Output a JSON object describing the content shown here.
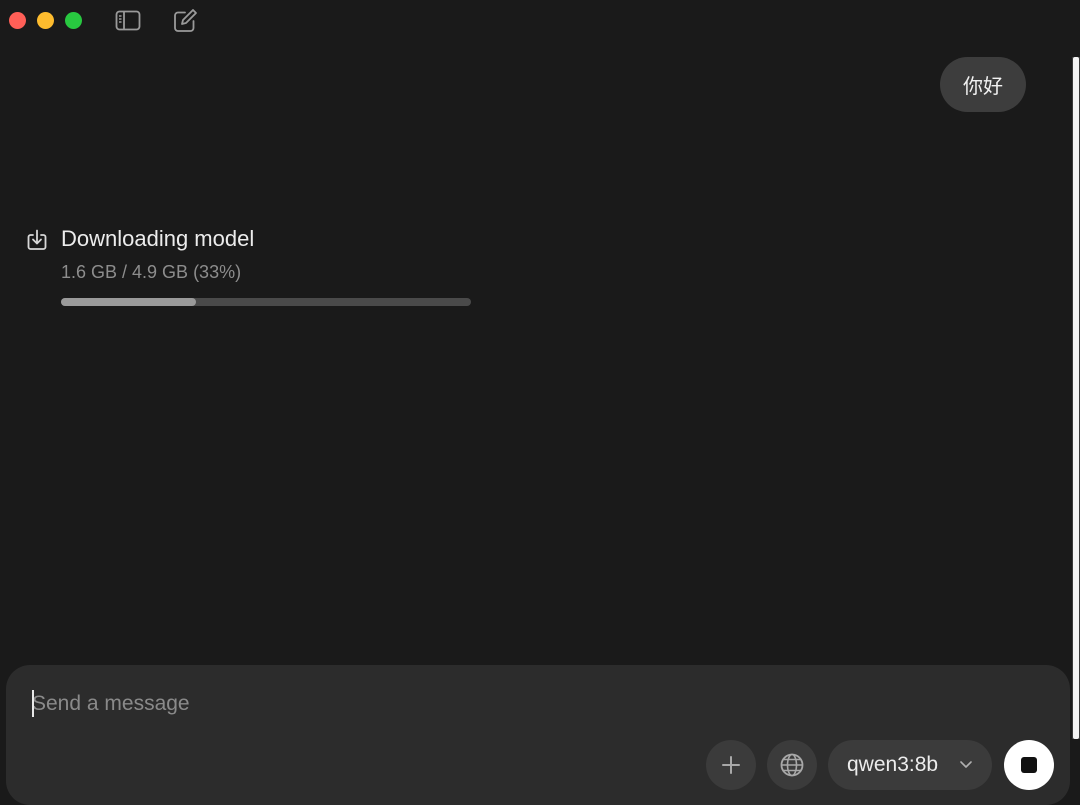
{
  "window": {
    "icons": [
      "sidebar-toggle-icon",
      "new-chat-icon"
    ]
  },
  "conversation": {
    "user_message": "你好",
    "download": {
      "title": "Downloading model",
      "progress_text": "1.6 GB / 4.9 GB (33%)",
      "progress_fraction": 0.33
    }
  },
  "composer": {
    "placeholder": "Send a message",
    "value": "",
    "model": "qwen3:8b",
    "icons": [
      "plus-icon",
      "globe-icon",
      "chevron-down-icon",
      "stop-icon"
    ]
  },
  "colors": {
    "background": "#1a1a1a",
    "bubble": "#3d3d3d",
    "composer": "#2c2c2c",
    "control": "#3b3b3b",
    "progress_track": "#4a4a4a",
    "progress_fill": "#9a9a9a",
    "stop_button": "#ffffff"
  }
}
